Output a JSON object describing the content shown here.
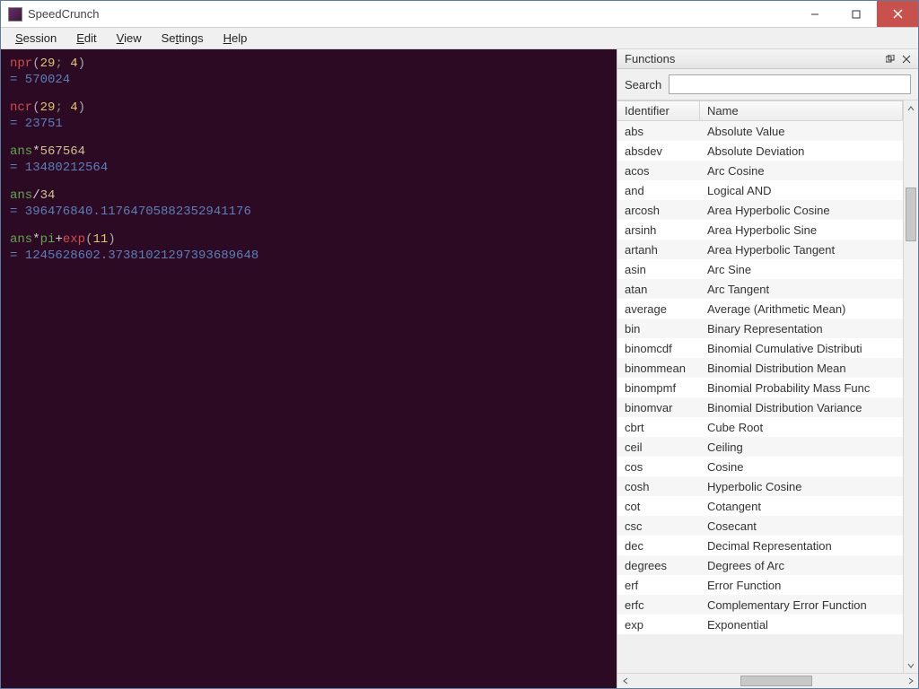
{
  "window": {
    "title": "SpeedCrunch"
  },
  "menus": {
    "session": "Session",
    "edit": "Edit",
    "view": "View",
    "settings": "Settings",
    "help": "Help"
  },
  "history": [
    {
      "tokens": [
        {
          "t": "fn",
          "v": "npr"
        },
        {
          "t": "paren",
          "v": "("
        },
        {
          "t": "num",
          "v": "29"
        },
        {
          "t": "sep",
          "v": "; "
        },
        {
          "t": "num",
          "v": "4"
        },
        {
          "t": "paren",
          "v": ")"
        }
      ],
      "result": "= 570024"
    },
    {
      "tokens": [
        {
          "t": "fn",
          "v": "ncr"
        },
        {
          "t": "paren",
          "v": "("
        },
        {
          "t": "num",
          "v": "29"
        },
        {
          "t": "sep",
          "v": "; "
        },
        {
          "t": "num",
          "v": "4"
        },
        {
          "t": "paren",
          "v": ")"
        }
      ],
      "result": "= 23751"
    },
    {
      "tokens": [
        {
          "t": "ans",
          "v": "ans"
        },
        {
          "t": "op",
          "v": "*"
        },
        {
          "t": "lit",
          "v": "567564"
        }
      ],
      "result": "= 13480212564"
    },
    {
      "tokens": [
        {
          "t": "ans",
          "v": "ans"
        },
        {
          "t": "op",
          "v": "/"
        },
        {
          "t": "lit",
          "v": "34"
        }
      ],
      "result": "= 396476840.11764705882352941176"
    },
    {
      "tokens": [
        {
          "t": "ans",
          "v": "ans"
        },
        {
          "t": "op",
          "v": "*"
        },
        {
          "t": "ans",
          "v": "pi"
        },
        {
          "t": "op",
          "v": "+"
        },
        {
          "t": "fn",
          "v": "exp"
        },
        {
          "t": "paren",
          "v": "("
        },
        {
          "t": "num",
          "v": "11"
        },
        {
          "t": "paren",
          "v": ")"
        }
      ],
      "result": "= 1245628602.37381021297393689648"
    }
  ],
  "panel": {
    "title": "Functions",
    "search_label": "Search",
    "search_value": "",
    "columns": {
      "identifier": "Identifier",
      "name": "Name"
    },
    "functions": [
      {
        "id": "abs",
        "name": "Absolute Value"
      },
      {
        "id": "absdev",
        "name": "Absolute Deviation"
      },
      {
        "id": "acos",
        "name": "Arc Cosine"
      },
      {
        "id": "and",
        "name": "Logical AND"
      },
      {
        "id": "arcosh",
        "name": "Area Hyperbolic Cosine"
      },
      {
        "id": "arsinh",
        "name": "Area Hyperbolic Sine"
      },
      {
        "id": "artanh",
        "name": "Area Hyperbolic Tangent"
      },
      {
        "id": "asin",
        "name": "Arc Sine"
      },
      {
        "id": "atan",
        "name": "Arc Tangent"
      },
      {
        "id": "average",
        "name": "Average (Arithmetic Mean)"
      },
      {
        "id": "bin",
        "name": "Binary Representation"
      },
      {
        "id": "binomcdf",
        "name": "Binomial Cumulative Distributi"
      },
      {
        "id": "binommean",
        "name": "Binomial Distribution Mean"
      },
      {
        "id": "binompmf",
        "name": "Binomial Probability Mass Func"
      },
      {
        "id": "binomvar",
        "name": "Binomial Distribution Variance"
      },
      {
        "id": "cbrt",
        "name": "Cube Root"
      },
      {
        "id": "ceil",
        "name": "Ceiling"
      },
      {
        "id": "cos",
        "name": "Cosine"
      },
      {
        "id": "cosh",
        "name": "Hyperbolic Cosine"
      },
      {
        "id": "cot",
        "name": "Cotangent"
      },
      {
        "id": "csc",
        "name": "Cosecant"
      },
      {
        "id": "dec",
        "name": "Decimal Representation"
      },
      {
        "id": "degrees",
        "name": "Degrees of Arc"
      },
      {
        "id": "erf",
        "name": "Error Function"
      },
      {
        "id": "erfc",
        "name": "Complementary Error Function"
      },
      {
        "id": "exp",
        "name": "Exponential"
      }
    ]
  }
}
